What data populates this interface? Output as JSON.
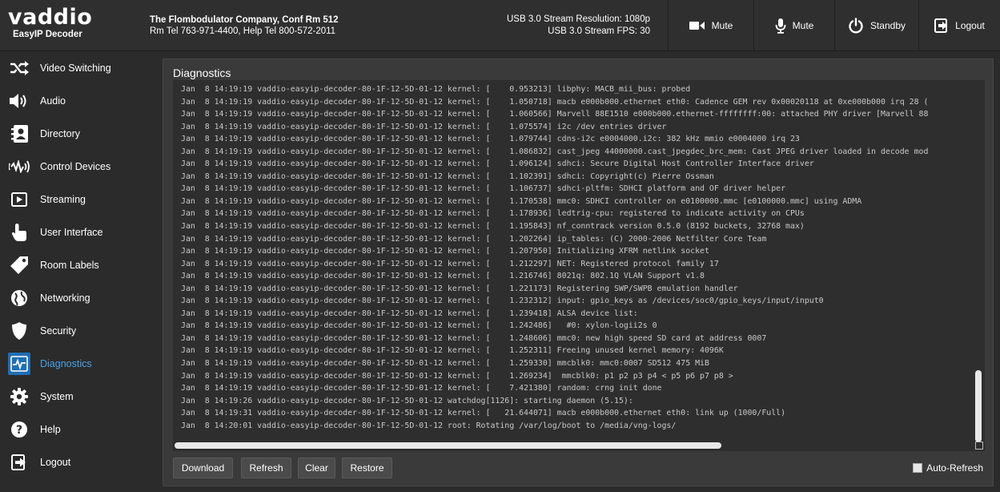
{
  "brand": {
    "logo": "vaddio",
    "product": "EasyIP Decoder"
  },
  "company": {
    "line1": "The Flombodulator Company, Conf Rm 512",
    "line2": "Rm Tel 763-971-4400, Help Tel 800-572-2011"
  },
  "stream": {
    "resolution": "USB 3.0 Stream Resolution: 1080p",
    "fps": "USB 3.0 Stream FPS: 30"
  },
  "header_buttons": {
    "video_mute": "Mute",
    "audio_mute": "Mute",
    "standby": "Standby",
    "logout": "Logout"
  },
  "sidebar": {
    "items": [
      {
        "label": "Video Switching",
        "icon": "video-switching-icon"
      },
      {
        "label": "Audio",
        "icon": "speaker-icon"
      },
      {
        "label": "Directory",
        "icon": "directory-icon"
      },
      {
        "label": "Control Devices",
        "icon": "control-devices-icon"
      },
      {
        "label": "Streaming",
        "icon": "play-icon"
      },
      {
        "label": "User Interface",
        "icon": "hand-pointer-icon"
      },
      {
        "label": "Room Labels",
        "icon": "tag-icon"
      },
      {
        "label": "Networking",
        "icon": "globe-icon"
      },
      {
        "label": "Security",
        "icon": "shield-icon"
      },
      {
        "label": "Diagnostics",
        "icon": "heartbeat-icon",
        "active": true
      },
      {
        "label": "System",
        "icon": "gear-icon"
      },
      {
        "label": "Help",
        "icon": "help-icon"
      },
      {
        "label": "Logout",
        "icon": "logout-icon"
      }
    ]
  },
  "main": {
    "title": "Diagnostics",
    "log_lines": [
      "Jan  8 14:19:19 vaddio-easyip-decoder-80-1F-12-5D-01-12 kernel: [    0.953213] libphy: MACB_mii_bus: probed",
      "Jan  8 14:19:19 vaddio-easyip-decoder-80-1F-12-5D-01-12 kernel: [    1.050718] macb e000b000.ethernet eth0: Cadence GEM rev 0x00020118 at 0xe000b000 irq 28 (",
      "Jan  8 14:19:19 vaddio-easyip-decoder-80-1F-12-5D-01-12 kernel: [    1.060566] Marvell 88E1510 e000b000.ethernet-ffffffff:00: attached PHY driver [Marvell 88",
      "Jan  8 14:19:19 vaddio-easyip-decoder-80-1F-12-5D-01-12 kernel: [    1.075574] i2c /dev entries driver",
      "Jan  8 14:19:19 vaddio-easyip-decoder-80-1F-12-5D-01-12 kernel: [    1.079744] cdns-i2c e0004000.i2c: 382 kHz mmio e0004000 irq 23",
      "Jan  8 14:19:19 vaddio-easyip-decoder-80-1F-12-5D-01-12 kernel: [    1.086832] cast_jpeg 44000000.cast_jpegdec_brc_mem: Cast JPEG driver loaded in decode mod",
      "Jan  8 14:19:19 vaddio-easyip-decoder-80-1F-12-5D-01-12 kernel: [    1.096124] sdhci: Secure Digital Host Controller Interface driver",
      "Jan  8 14:19:19 vaddio-easyip-decoder-80-1F-12-5D-01-12 kernel: [    1.102391] sdhci: Copyright(c) Pierre Ossman",
      "Jan  8 14:19:19 vaddio-easyip-decoder-80-1F-12-5D-01-12 kernel: [    1.106737] sdhci-pltfm: SDHCI platform and OF driver helper",
      "Jan  8 14:19:19 vaddio-easyip-decoder-80-1F-12-5D-01-12 kernel: [    1.170538] mmc0: SDHCI controller on e0100000.mmc [e0100000.mmc] using ADMA",
      "Jan  8 14:19:19 vaddio-easyip-decoder-80-1F-12-5D-01-12 kernel: [    1.178936] ledtrig-cpu: registered to indicate activity on CPUs",
      "Jan  8 14:19:19 vaddio-easyip-decoder-80-1F-12-5D-01-12 kernel: [    1.195843] nf_conntrack version 0.5.0 (8192 buckets, 32768 max)",
      "Jan  8 14:19:19 vaddio-easyip-decoder-80-1F-12-5D-01-12 kernel: [    1.202264] ip_tables: (C) 2000-2006 Netfilter Core Team",
      "Jan  8 14:19:19 vaddio-easyip-decoder-80-1F-12-5D-01-12 kernel: [    1.207950] Initializing XFRM netlink socket",
      "Jan  8 14:19:19 vaddio-easyip-decoder-80-1F-12-5D-01-12 kernel: [    1.212297] NET: Registered protocol family 17",
      "Jan  8 14:19:19 vaddio-easyip-decoder-80-1F-12-5D-01-12 kernel: [    1.216746] 8021q: 802.1Q VLAN Support v1.8",
      "Jan  8 14:19:19 vaddio-easyip-decoder-80-1F-12-5D-01-12 kernel: [    1.221173] Registering SWP/SWPB emulation handler",
      "Jan  8 14:19:19 vaddio-easyip-decoder-80-1F-12-5D-01-12 kernel: [    1.232312] input: gpio_keys as /devices/soc0/gpio_keys/input/input0",
      "Jan  8 14:19:19 vaddio-easyip-decoder-80-1F-12-5D-01-12 kernel: [    1.239418] ALSA device list:",
      "Jan  8 14:19:19 vaddio-easyip-decoder-80-1F-12-5D-01-12 kernel: [    1.242486]   #0: xylon-logii2s 0",
      "Jan  8 14:19:19 vaddio-easyip-decoder-80-1F-12-5D-01-12 kernel: [    1.248606] mmc0: new high speed SD card at address 0007",
      "Jan  8 14:19:19 vaddio-easyip-decoder-80-1F-12-5D-01-12 kernel: [    1.252311] Freeing unused kernel memory: 4096K",
      "Jan  8 14:19:19 vaddio-easyip-decoder-80-1F-12-5D-01-12 kernel: [    1.259330] mmcblk0: mmc0:0007 SD512 475 MiB",
      "Jan  8 14:19:19 vaddio-easyip-decoder-80-1F-12-5D-01-12 kernel: [    1.269234]  mmcblk0: p1 p2 p3 p4 < p5 p6 p7 p8 >",
      "Jan  8 14:19:19 vaddio-easyip-decoder-80-1F-12-5D-01-12 kernel: [    7.421380] random: crng init done",
      "Jan  8 14:19:26 vaddio-easyip-decoder-80-1F-12-5D-01-12 watchdog[1126]: starting daemon (5.15):",
      "Jan  8 14:19:31 vaddio-easyip-decoder-80-1F-12-5D-01-12 kernel: [   21.644071] macb e000b000.ethernet eth0: link up (1000/Full)",
      "Jan  8 14:20:01 vaddio-easyip-decoder-80-1F-12-5D-01-12 root: Rotating /var/log/boot to /media/vng-logs/"
    ],
    "buttons": {
      "download": "Download",
      "refresh": "Refresh",
      "clear": "Clear",
      "restore": "Restore"
    },
    "auto_refresh": {
      "label": "Auto-Refresh",
      "checked": false
    }
  },
  "colors": {
    "accent": "#4aa3e8",
    "active_icon_bg": "#1f6fb5",
    "background": "#2b2b2b",
    "panel": "#3a3a3a"
  }
}
